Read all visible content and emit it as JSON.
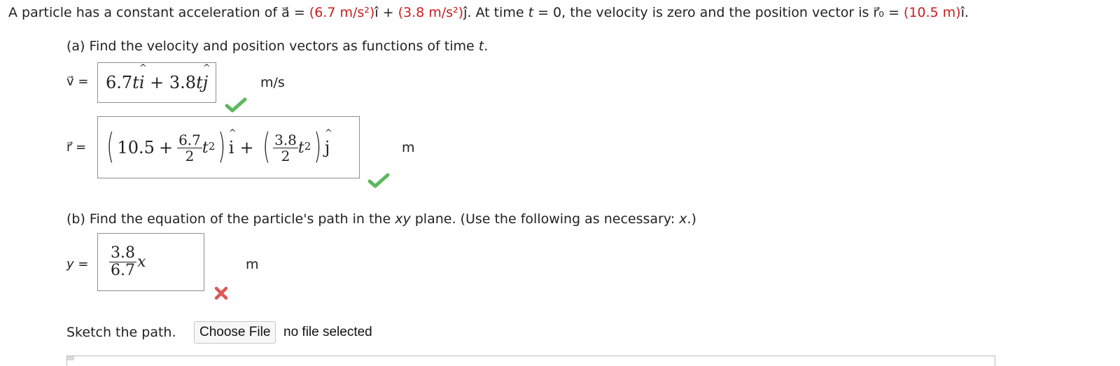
{
  "problem": {
    "intro_1": "A particle has a constant acceleration of ",
    "a_symbol": "a⃗",
    "eq1": " = ",
    "a_x": "(6.7 m/s²)",
    "i_hat": "î",
    "plus": " + ",
    "a_y": "(3.8 m/s²)",
    "j_hat": "ĵ",
    "intro_2": ". At time ",
    "t_var": "t",
    "intro_3": " = 0, the velocity is zero and the position vector is ",
    "r0_symbol": "r⃗₀",
    "eq2": " = ",
    "r0_value": "(10.5 m)",
    "r0_unit_vec": "î.",
    "part_a_prompt_1": "(a) Find the velocity and position vectors as functions of time ",
    "part_a_prompt_t": "t",
    "part_a_prompt_2": ".",
    "part_b_prompt_1": "(b) Find the equation of the particle's path in the ",
    "part_b_prompt_xy": "xy",
    "part_b_prompt_2": " plane. (Use the following as necessary: ",
    "part_b_prompt_x": "x",
    "part_b_prompt_3": ".)"
  },
  "velocity": {
    "label": "v⃗ =",
    "answer": {
      "coef1": "6.7",
      "t1": "t",
      "i": "i",
      "plus": "+",
      "coef2": "3.8",
      "t2": "t",
      "j": "j"
    },
    "unit": "m/s",
    "status": "correct"
  },
  "position": {
    "label": "r⃗ =",
    "answer": {
      "open1": "(",
      "const": "10.5",
      "plus1": "+",
      "num1": "6.7",
      "den1": "2",
      "t1": "t",
      "exp1": "2",
      "close1": ")",
      "i": "i",
      "plus2": "+",
      "open2": "(",
      "num2": "3.8",
      "den2": "2",
      "t2": "t",
      "exp2": "2",
      "close2": ")",
      "j": "j"
    },
    "unit": "m",
    "status": "correct"
  },
  "path": {
    "label": "y =",
    "answer": {
      "num": "3.8",
      "den": "6.7",
      "var": "x"
    },
    "unit": "m",
    "status": "incorrect"
  },
  "sketch": {
    "label": "Sketch the path.",
    "button": "Choose File",
    "file_status": "no file selected"
  },
  "colors": {
    "given_value": "#c81e1e",
    "correct": "#5cb85c",
    "incorrect": "#e05555",
    "box_border": "#8f8f8f"
  }
}
